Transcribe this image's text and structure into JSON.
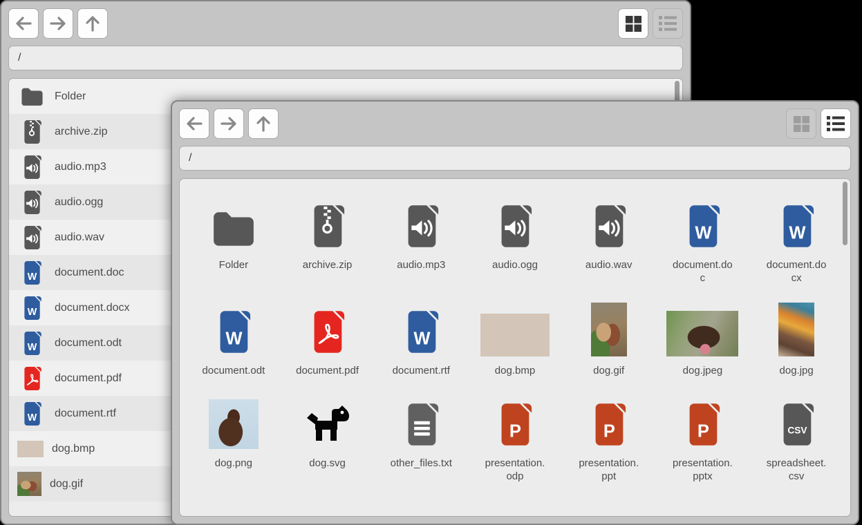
{
  "app": {
    "background": "#000000"
  },
  "icons": {
    "back": "arrow-left-icon",
    "forward": "arrow-right-icon",
    "up": "arrow-up-icon",
    "grid_view": "grid-view-icon",
    "list_view": "list-view-icon"
  },
  "colors": {
    "window_chrome": "#c5c5c5",
    "window_border": "#858585",
    "panel_bg": "#ececec",
    "generic_gray": "#575757",
    "txt_gray": "#606060",
    "word_blue": "#2e5c9e",
    "pdf_red": "#e52620",
    "ppt_orange": "#c0431f",
    "label_text": "#4b4b4b"
  },
  "windows": {
    "back": {
      "view": "list",
      "path": "/",
      "files": [
        {
          "name": "Folder",
          "kind": "folder"
        },
        {
          "name": "archive.zip",
          "kind": "zip"
        },
        {
          "name": "audio.mp3",
          "kind": "audio"
        },
        {
          "name": "audio.ogg",
          "kind": "audio"
        },
        {
          "name": "audio.wav",
          "kind": "audio"
        },
        {
          "name": "document.doc",
          "kind": "word"
        },
        {
          "name": "document.docx",
          "kind": "word"
        },
        {
          "name": "document.odt",
          "kind": "word"
        },
        {
          "name": "document.pdf",
          "kind": "pdf"
        },
        {
          "name": "document.rtf",
          "kind": "word"
        },
        {
          "name": "dog.bmp",
          "kind": "photo-bmp"
        },
        {
          "name": "dog.gif",
          "kind": "photo-gif"
        }
      ]
    },
    "front": {
      "view": "grid",
      "path": "/",
      "files": [
        {
          "name": "Folder",
          "kind": "folder"
        },
        {
          "name": "archive.zip",
          "kind": "zip"
        },
        {
          "name": "audio.mp3",
          "kind": "audio"
        },
        {
          "name": "audio.ogg",
          "kind": "audio"
        },
        {
          "name": "audio.wav",
          "kind": "audio"
        },
        {
          "name": "document.doc",
          "kind": "word"
        },
        {
          "name": "document.docx",
          "kind": "word"
        },
        {
          "name": "document.odt",
          "kind": "word"
        },
        {
          "name": "document.pdf",
          "kind": "pdf"
        },
        {
          "name": "document.rtf",
          "kind": "word"
        },
        {
          "name": "dog.bmp",
          "kind": "photo-bmp"
        },
        {
          "name": "dog.gif",
          "kind": "photo-gif"
        },
        {
          "name": "dog.jpeg",
          "kind": "photo-jpeg"
        },
        {
          "name": "dog.jpg",
          "kind": "photo-jpg"
        },
        {
          "name": "dog.png",
          "kind": "photo-png"
        },
        {
          "name": "dog.svg",
          "kind": "dogsvg"
        },
        {
          "name": "other_files.txt",
          "kind": "txt"
        },
        {
          "name": "presentation.odp",
          "kind": "ppt"
        },
        {
          "name": "presentation.ppt",
          "kind": "ppt"
        },
        {
          "name": "presentation.pptx",
          "kind": "ppt"
        },
        {
          "name": "spreadsheet.csv",
          "kind": "csv"
        }
      ]
    }
  }
}
